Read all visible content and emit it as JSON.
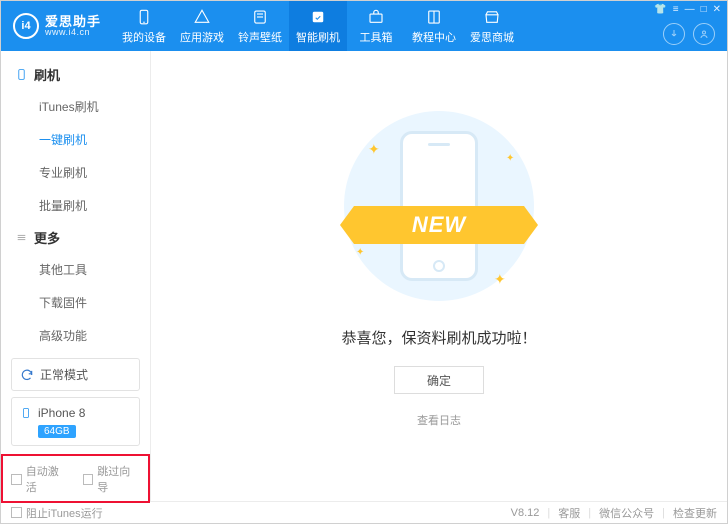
{
  "header": {
    "logo_text": "i4",
    "brand_cn": "爱思助手",
    "brand_en": "www.i4.cn",
    "nav": [
      {
        "label": "我的设备",
        "icon": "phone"
      },
      {
        "label": "应用游戏",
        "icon": "apps"
      },
      {
        "label": "铃声壁纸",
        "icon": "note"
      },
      {
        "label": "智能刷机",
        "icon": "flash",
        "active": true
      },
      {
        "label": "工具箱",
        "icon": "toolbox"
      },
      {
        "label": "教程中心",
        "icon": "book"
      },
      {
        "label": "爱思商城",
        "icon": "shop"
      }
    ]
  },
  "sidebar": {
    "group1_title": "刷机",
    "group1_items": [
      "iTunes刷机",
      "一键刷机",
      "专业刷机",
      "批量刷机"
    ],
    "group1_active_index": 1,
    "group2_title": "更多",
    "group2_items": [
      "其他工具",
      "下载固件",
      "高级功能"
    ],
    "mode_label": "正常模式",
    "device_name": "iPhone 8",
    "device_storage": "64GB",
    "auto_activate_label": "自动激活",
    "skip_guide_label": "跳过向导"
  },
  "main": {
    "ribbon_text": "NEW",
    "success_text": "恭喜您，保资料刷机成功啦！",
    "confirm_label": "确定",
    "log_link": "查看日志"
  },
  "footer": {
    "block_itunes_label": "阻止iTunes运行",
    "version": "V8.12",
    "links": [
      "客服",
      "微信公众号",
      "检查更新"
    ]
  }
}
